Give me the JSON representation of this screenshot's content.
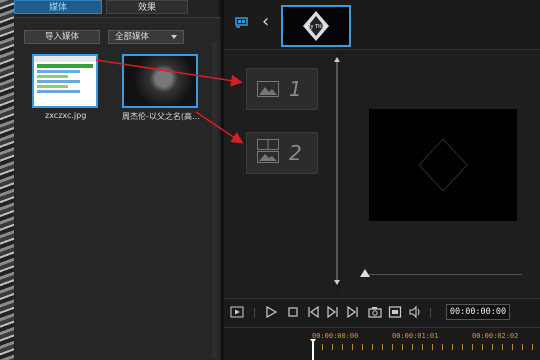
{
  "media_panel": {
    "tabs": [
      {
        "label": "媒体",
        "active": true
      },
      {
        "label": "效果",
        "active": false
      }
    ],
    "import_button": "导入媒体",
    "filter_select": "全部媒体",
    "items": [
      {
        "name": "zxczxc.jpg",
        "type": "image"
      },
      {
        "name": "周杰伦-以父之名(高...",
        "type": "video"
      }
    ]
  },
  "title_bar": {
    "icons": [
      "add-media-icon",
      "chevron-left-icon"
    ],
    "title_thumb_text": "My Title"
  },
  "tracks": [
    {
      "number": "1",
      "icon": "image-track-icon"
    },
    {
      "number": "2",
      "icon": "split-track-icon"
    }
  ],
  "controls": {
    "icons": [
      "snapshot-track-icon",
      "play-icon",
      "stop-icon",
      "prev-frame-icon",
      "next-frame-icon",
      "next-clip-icon",
      "camera-icon",
      "layout-icon",
      "volume-icon"
    ],
    "timecode": "00:00:00:00"
  },
  "timeline": {
    "ruler_labels": [
      "00:00:00:00",
      "00:00:01:01",
      "00:00:02:02"
    ]
  },
  "colors": {
    "accent": "#3c9be0",
    "arrow": "#d42020",
    "ruler": "#d29a3a",
    "background": "#1c1c1c"
  }
}
